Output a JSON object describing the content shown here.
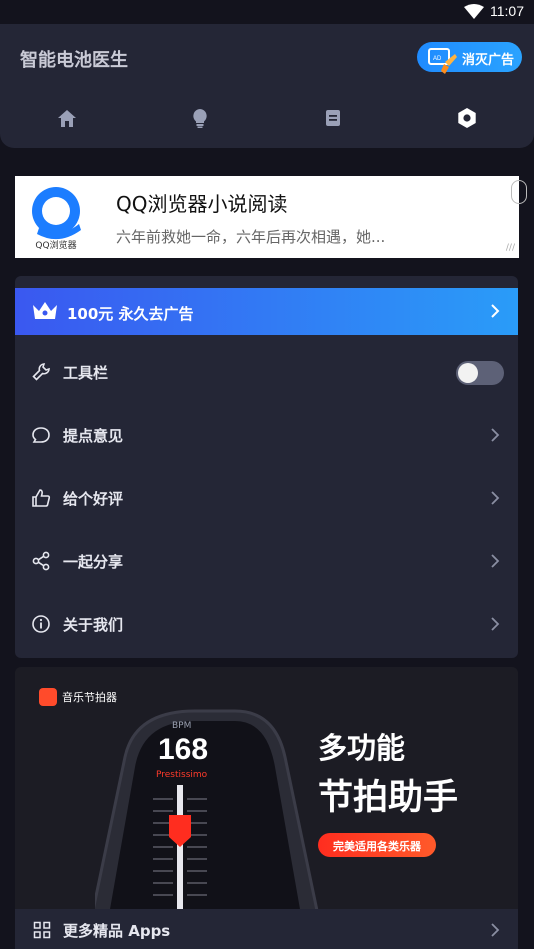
{
  "status": {
    "time": "11:07",
    "wifi_icon": "wifi-icon"
  },
  "header": {
    "title": "智能电池医生",
    "remove_ads_label": "消灭广告",
    "nav_tabs": [
      "home-icon",
      "bulb-icon",
      "note-icon",
      "settings-icon"
    ],
    "active_tab": 3
  },
  "ad": {
    "headline": "QQ浏览器小说阅读",
    "description": "六年前救她一命，六年后再次相遇，她...",
    "logo_text": "QQ浏览器"
  },
  "menu": {
    "vip_label": "100元 永久去广告",
    "items": [
      {
        "label": "工具栏",
        "icon": "wrench-icon",
        "control": "toggle",
        "on": false
      },
      {
        "label": "提点意见",
        "icon": "chat-bubble-icon",
        "control": "chevron"
      },
      {
        "label": "给个好评",
        "icon": "thumbs-up-icon",
        "control": "chevron"
      },
      {
        "label": "一起分享",
        "icon": "share-icon",
        "control": "chevron"
      },
      {
        "label": "关于我们",
        "icon": "info-icon",
        "control": "chevron"
      }
    ]
  },
  "promo": {
    "app_name": "音乐节拍器",
    "bpm_label": "BPM",
    "bpm_value": "168",
    "tempo_name": "Prestissimo",
    "headline_1": "多功能",
    "headline_2": "节拍助手",
    "tagline": "完美适用各类乐器"
  },
  "more": {
    "label": "更多精品 Apps"
  },
  "colors": {
    "accent": "#1f8bff",
    "panel": "#242636",
    "background": "#13131d",
    "promo_red": "#ff2d1f"
  }
}
